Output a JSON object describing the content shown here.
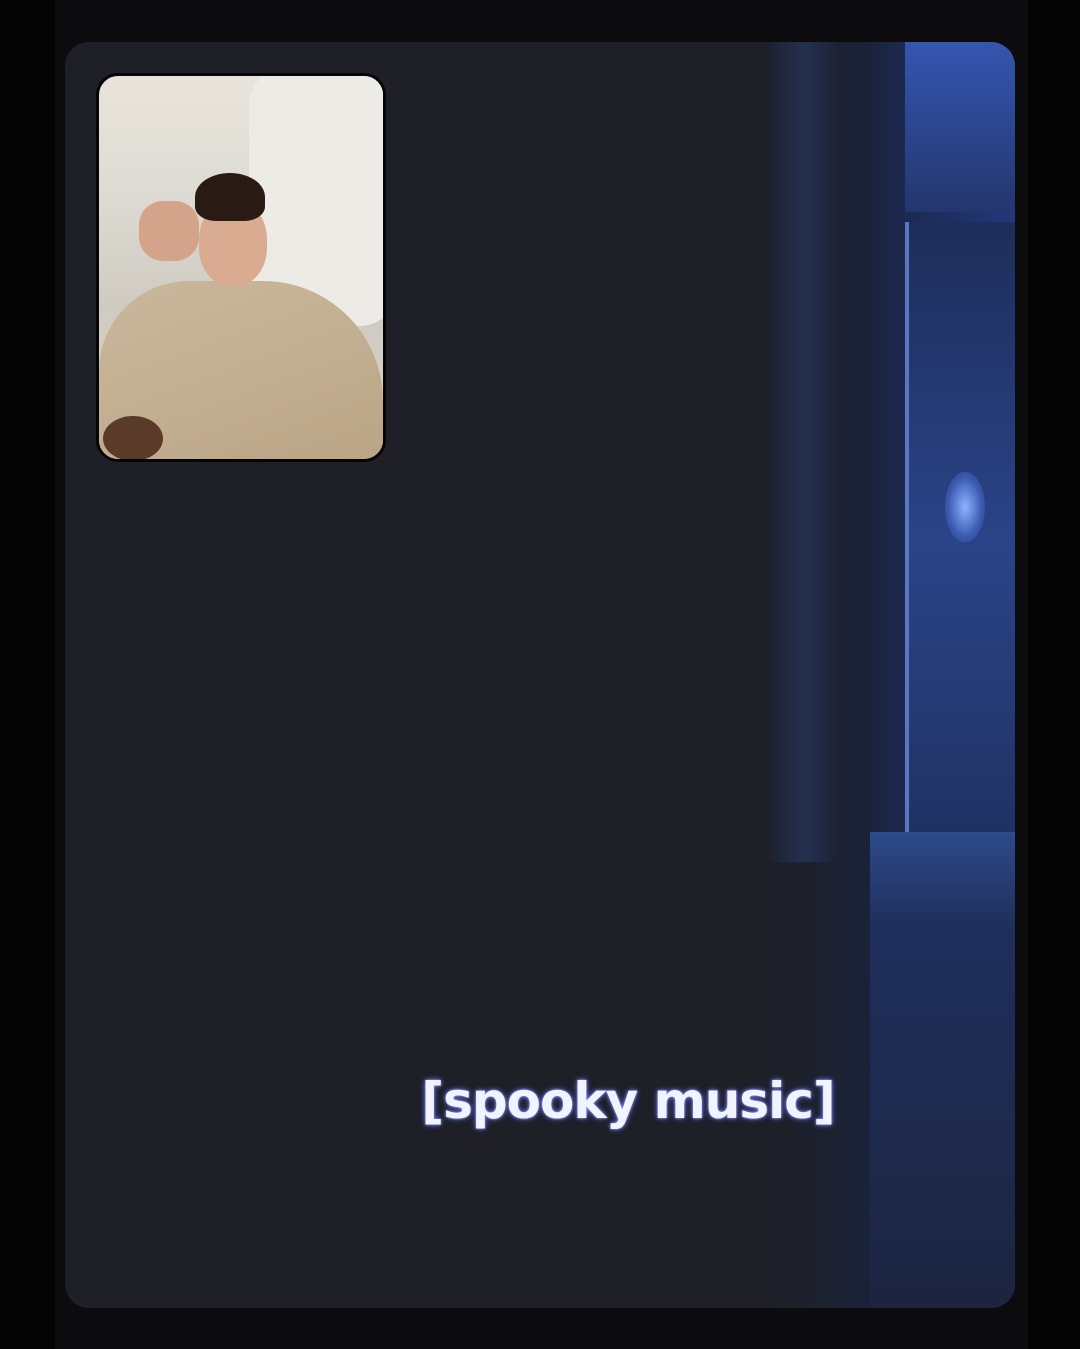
{
  "call": {
    "subtitle": "[spooky music]",
    "self_view": "pip-self-video",
    "colors": {
      "background": "#0c0c0e",
      "video_dark": "#1e1f27",
      "scene_blue": "#2a4488",
      "subtitle": "#f1f3ff"
    }
  }
}
